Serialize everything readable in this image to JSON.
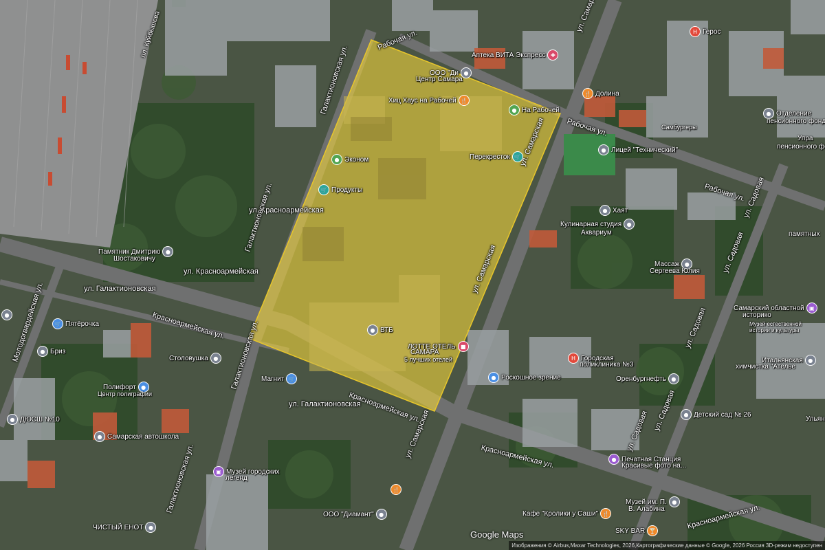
{
  "map": {
    "highlight_color": "#f2d33a",
    "logo": "Google Maps",
    "attribution": "Изображения © Airbus,Maxar Technologies, 2026,Картографические данные © Google, 2026",
    "attribution_extra": "Россия   3D-режим недоступен"
  },
  "streets": {
    "rabochaya_top": "Рабочая ул.",
    "kuibysheva": "пл. Куйбышева",
    "galaktionovskaya_top": "Галактионовская ул.",
    "krasnoarmeyskaya_top": "ул. Красноармейская",
    "krasnoarmeyskaya_left": "ул. Красноармейская",
    "galaktionovskaya_left": "ул. Галактионовская",
    "galaktionovskaya_vert": "Галактионовская ул.",
    "krasnoarmeyskaya_diag": "Красноармейская ул.",
    "krasnoarmeyskaya_diag2": "Красноармейская ул.",
    "krasnoarmeyskaya_bottom": "Красноармейская ул.",
    "krasnoarmeyskaya_far": "Красноармейская ул.",
    "samarskaya_top": "ул. Самарская",
    "samarskaya_mid": "ул. Самарская",
    "samarskaya_bottom": "ул. Самарская",
    "samarskaya_right": "ул. Самарская",
    "rabochaya_right": "Рабочая ул.",
    "rabochaya_right2": "Рабочая ул.",
    "sadovaya_1": "ул. Садовая",
    "sadovaya_2": "ул. Садовая",
    "sadovaya_3": "ул. Садовая",
    "sadovaya_4": "ул. Садовая",
    "sadovaya_5": "ул. Садовая",
    "molodogvardeyskaya": "Молодогвардейская ул.",
    "galaktionovskaya_bottom": "ул. Галактионовская",
    "galaktionovskaya_bl": "Галактионовская ул.",
    "palaktionovskaya": "Галактионовская ул."
  },
  "pois": {
    "apteka": "Аптека ВИТА Экспресс",
    "geros": "Герос",
    "ooo_di": "ООО \"Ди",
    "center_samara": "Центр Самара",
    "house": "Хиц Хаус на Рабочей",
    "na_rabochey": "На Рабочей",
    "dolina": "Долина",
    "upfr": "УПФ Отделение пенсионного фонда",
    "otdelenie": "Отделение",
    "perekrestok": "Перекресток",
    "ekonom": "Эконом",
    "produkty": "Продукты",
    "licey": "Лицей \"Технический\"",
    "samburger": "Самбургеры",
    "khayat": "Хаят",
    "kulinar_1": "Кулинарная студия",
    "kulinar_2": "Аквариум",
    "pamyatnik_1": "Памятник Дмитрию",
    "pamyatnik_2": "Шостаковичу",
    "massage_1": "Массаж",
    "massage_2": "Сергеева Юлия",
    "lotte_1": "ЛОТТЕ ОТЕЛЬ",
    "lotte_2": "САМАРА",
    "lotte_3": "5 лучших отелей",
    "vtb": "ВТБ",
    "pyaterochka": "Пятёрочка",
    "briz": "Бриз",
    "stolovushka": "Столовушка",
    "magnit": "Магнит",
    "poliport_1": "Полифорт",
    "poliport_2": "Центр полиграфии",
    "dyush": "ДЮСШ №10",
    "avtoshkola": "Самарская автошкола",
    "muzey_1": "Музей городских",
    "muzey_2": "легенд",
    "roskosh": "Роскошное зрение",
    "poliklinika_1": "Городская",
    "poliklinika_2": "поликлиника №3",
    "orenburg": "Оренбургнефть",
    "italyanskaya_1": "Итальянская",
    "italyanskaya_2": "химчистка \"Ателье",
    "oblast_1": "Самарский областной",
    "oblast_2": "историко",
    "oblast_3": "Музей естественной",
    "oblast_4": "истории и культуры",
    "detsad": "Детский сад № 26",
    "pechat_1": "Печатная Станция",
    "pechat_2": "Красивые фото на...",
    "muzey_alabina_1": "Музей им. П.",
    "muzey_alabina_2": "В. Алабина",
    "kafe": "Кафе \"Кролики у Саши\"",
    "sky_bar": "SKY BAR",
    "diamant": "ООО \"Диамант\"",
    "chisty_enot": "ЧИСТЫЙ ЕНОТ",
    "ulyan": "Ульян",
    "upr": "Упра",
    "pens": "пенсионного фонд",
    "pamyatnyh": "памятных"
  }
}
